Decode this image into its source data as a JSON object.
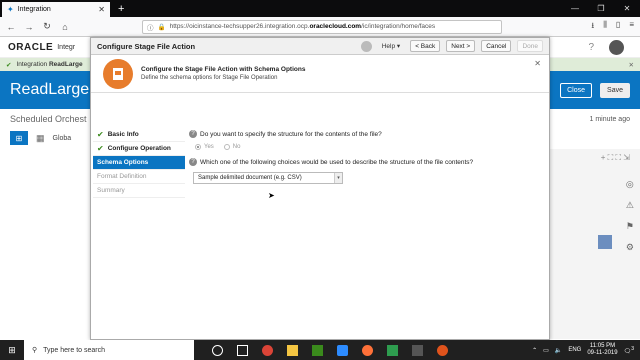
{
  "browser": {
    "tab_title": "Integration",
    "url_prefix": "https://oicinstance-techsupper26.integration.ocp.",
    "url_domain": "oraclecloud.com",
    "url_suffix": "/ic/integration/home/faces"
  },
  "app": {
    "brand": "ORACLE",
    "brand_sub": "Integr",
    "notification_prefix": "Integration ",
    "notification_bold": "ReadLarge",
    "integration_title": "ReadLargeFi",
    "close_label": "Close",
    "save_label": "Save",
    "subtitle": "Scheduled Orchest",
    "last_saved": "1 minute ago",
    "global_label": "Globa"
  },
  "dialog": {
    "title": "Configure Stage File Action",
    "help_label": "Help",
    "back_label": "< Back",
    "next_label": "Next >",
    "cancel_label": "Cancel",
    "done_label": "Done",
    "banner_heading": "Configure the Stage File Action with Schema Options",
    "banner_sub": "Define the schema options for Stage File Operation",
    "steps": [
      {
        "label": "Basic Info",
        "state": "done"
      },
      {
        "label": "Configure Operation",
        "state": "done"
      },
      {
        "label": "Schema Options",
        "state": "active"
      },
      {
        "label": "Format Definition",
        "state": "pending"
      },
      {
        "label": "Summary",
        "state": "pending"
      }
    ],
    "question1": "Do you want to specify the structure for the contents of the file?",
    "yes_label": "Yes",
    "no_label": "No",
    "question2": "Which one of the following choices would be used to describe the structure of the file contents?",
    "select_value": "Sample delimited document (e.g. CSV)"
  },
  "taskbar": {
    "search_placeholder": "Type here to search",
    "language": "ENG",
    "time": "11:05 PM",
    "date": "09-11-2019",
    "notification_count": "3"
  },
  "colors": {
    "accent": "#0b75c2",
    "banner_icon": "#e77c2c",
    "success": "#3a8a1c"
  }
}
